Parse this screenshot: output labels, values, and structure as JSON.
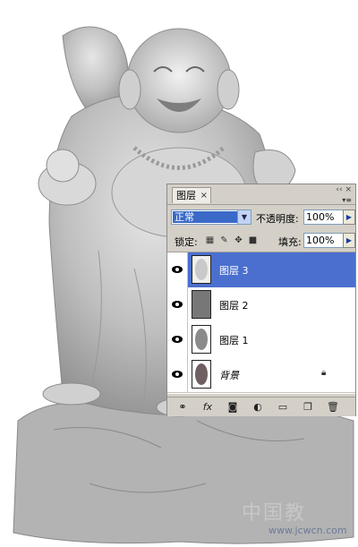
{
  "panel": {
    "tab_label": "图层",
    "tab_close": "×",
    "win_ctrls": "‹‹ ×",
    "menu_btn": "▾≡"
  },
  "blend": {
    "mode": "正常",
    "opacity_label": "不透明度:",
    "opacity_value": "100%"
  },
  "lock": {
    "label": "锁定:",
    "fill_label": "填充:",
    "fill_value": "100%"
  },
  "layers": [
    {
      "name": "图层 3",
      "selected": true
    },
    {
      "name": "图层 2",
      "selected": false
    },
    {
      "name": "图层 1",
      "selected": false
    },
    {
      "name": "背景",
      "selected": false,
      "locked": true
    }
  ],
  "watermark": {
    "text": "中国教",
    "url": "www.jcwcn.com"
  },
  "colors": {
    "selection": "#4a6fce",
    "panel": "#d4d0c8",
    "statue": "#bdbdbd"
  }
}
